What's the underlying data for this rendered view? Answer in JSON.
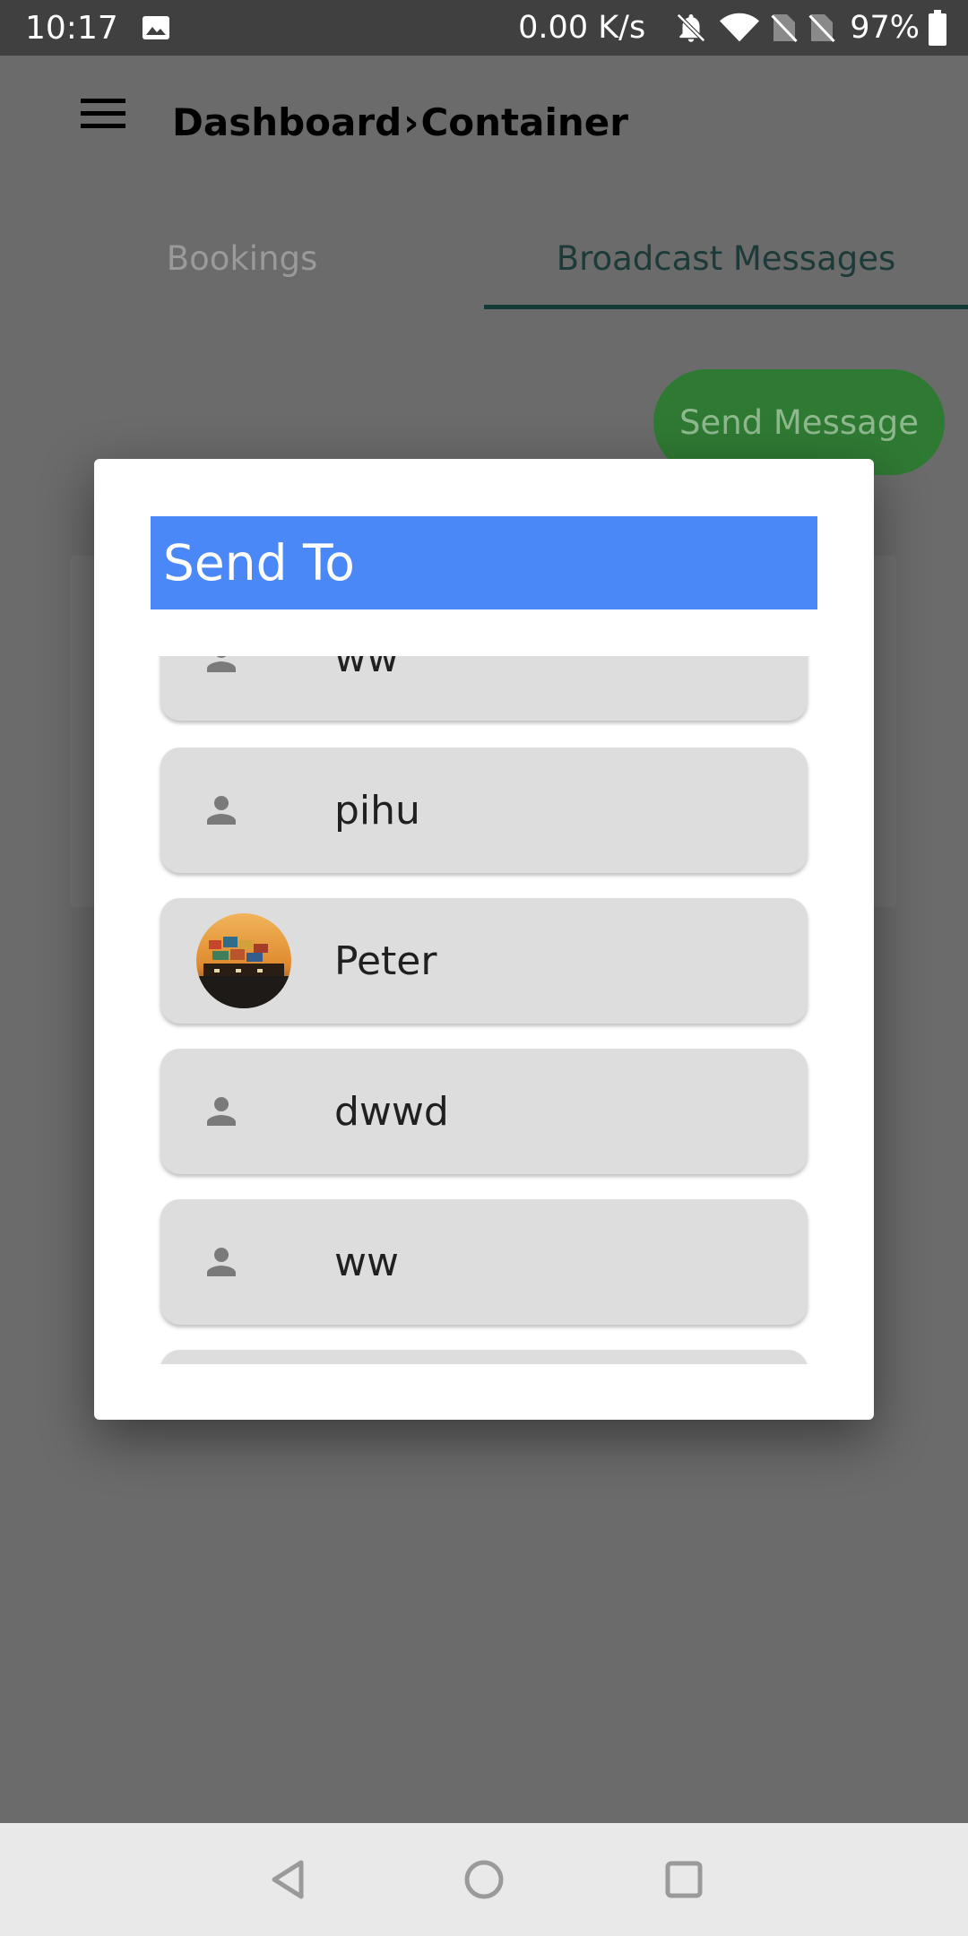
{
  "status_bar": {
    "time": "10:17",
    "net_speed": "0.00 K/s",
    "battery": "97%",
    "icons": [
      "gallery-icon",
      "bell-off-icon",
      "wifi-icon",
      "no-sim-icon",
      "no-sim-icon",
      "battery-icon"
    ]
  },
  "header": {
    "menu_icon": "hamburger-menu-icon",
    "breadcrumb_part1": "Dashboard",
    "breadcrumb_sep": "›",
    "breadcrumb_part2": "Container"
  },
  "tabs": [
    {
      "label": "Bookings",
      "active": false
    },
    {
      "label": "Broadcast Messages",
      "active": true
    }
  ],
  "send_message_label": "Send Message",
  "dialog": {
    "title": "Send To",
    "recipients": [
      {
        "name": "ww",
        "avatar": "person-icon",
        "partial": true
      },
      {
        "name": "pihu",
        "avatar": "person-icon"
      },
      {
        "name": "Peter",
        "avatar": "photo"
      },
      {
        "name": "dwwd",
        "avatar": "person-icon"
      },
      {
        "name": "ww",
        "avatar": "person-icon"
      }
    ]
  },
  "colors": {
    "dialog_title_bg": "#4a88f7",
    "send_button_bg": "#2f7a33",
    "tab_active_underline": "#123a36",
    "scrim": "#6b6b6b"
  },
  "nav_bar": {
    "buttons": [
      "back-triangle-icon",
      "home-circle-icon",
      "recents-square-icon"
    ]
  }
}
